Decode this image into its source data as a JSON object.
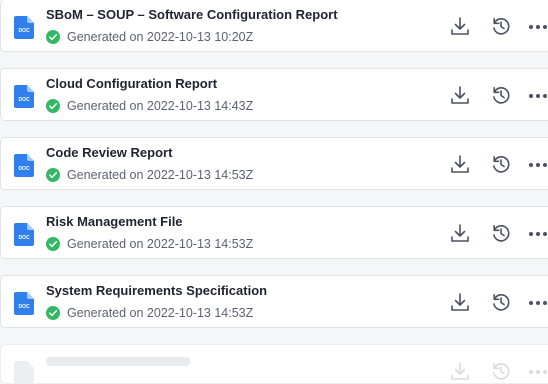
{
  "reports": [
    {
      "title": "SBoM – SOUP – Software Configuration Report",
      "status": "Generated on 2022-10-13 10:20Z",
      "icon": "doc-file-icon",
      "badge": "DOC"
    },
    {
      "title": "Cloud Configuration Report",
      "status": "Generated on 2022-10-13 14:43Z",
      "icon": "doc-file-icon",
      "badge": "DOC"
    },
    {
      "title": "Code Review Report",
      "status": "Generated on 2022-10-13 14:53Z",
      "icon": "doc-file-icon",
      "badge": "DOC"
    },
    {
      "title": "Risk Management File",
      "status": "Generated on 2022-10-13 14:53Z",
      "icon": "doc-file-icon",
      "badge": "DOC"
    },
    {
      "title": "System Requirements Specification",
      "status": "Generated on 2022-10-13 14:53Z",
      "icon": "doc-file-icon",
      "badge": "DOC"
    }
  ],
  "actions": {
    "download": "download-icon",
    "history": "history-icon",
    "more": "more-icon"
  },
  "colors": {
    "doc_blue": "#2f80ed",
    "success_green": "#34b866",
    "icon_gray": "#4a5260"
  }
}
